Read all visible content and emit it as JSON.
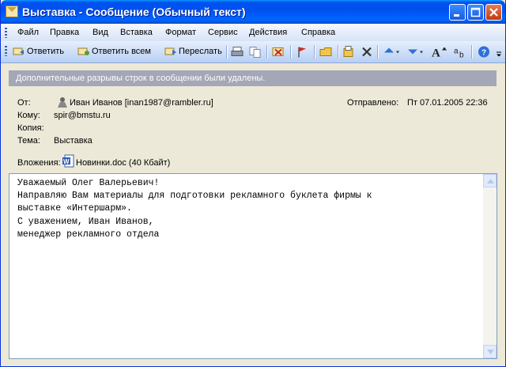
{
  "window": {
    "title": "Выставка - Сообщение (Обычный текст)"
  },
  "menu": [
    "Файл",
    "Правка",
    "Вид",
    "Вставка",
    "Формат",
    "Сервис",
    "Действия",
    "Справка"
  ],
  "toolbar": {
    "reply": "Ответить",
    "reply_all": "Ответить всем",
    "forward": "Переслать"
  },
  "info_bar": "Дополнительные разрывы строк в сообщении были удалены.",
  "header": {
    "from_label": "От:",
    "from_value": "Иван Иванов [inan1987@rambler.ru]",
    "sent_label": "Отправлено:",
    "sent_value": "Пт 07.01.2005 22:36",
    "to_label": "Кому:",
    "to_value": "spir@bmstu.ru",
    "cc_label": "Копия:",
    "cc_value": "",
    "subject_label": "Тема:",
    "subject_value": "Выставка",
    "attach_label": "Вложения:",
    "attach_value": "Новинки.doc (40 Кбайт)"
  },
  "body_lines": [
    "Уважаемый Олег Валерьевич!",
    "",
    "",
    "Направляю Вам материалы для подготовки рекламного буклета фирмы к",
    "выставке «Интершарм».",
    "",
    "С уважением, Иван Иванов,",
    "",
    "менеджер рекламного отдела"
  ]
}
